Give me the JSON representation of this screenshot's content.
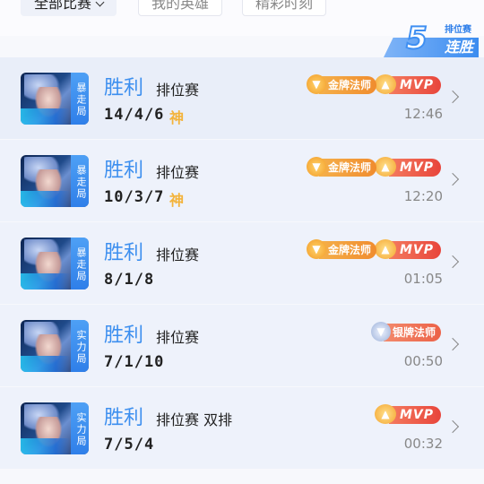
{
  "filters": [
    {
      "label": "全部比赛",
      "active": true
    },
    {
      "label": "我的英雄",
      "active": false
    },
    {
      "label": "精彩时刻",
      "active": false
    }
  ],
  "streak": {
    "count": "5",
    "sub_label": "排位赛",
    "label": "连胜"
  },
  "colors": {
    "accent": "#3d8fef",
    "gold": "#f3b33b",
    "tag_blue": "#2f7fe9"
  },
  "matches": [
    {
      "mode": "暴走局",
      "result": "胜利",
      "type": "排位赛",
      "kda": "14/4/6",
      "god": "神",
      "medal": "金牌法师",
      "medal_kind": "gold",
      "mvp": "MVP",
      "time": "12:46",
      "avatar_icon": "hero-portrait"
    },
    {
      "mode": "暴走局",
      "result": "胜利",
      "type": "排位赛",
      "kda": "10/3/7",
      "god": "神",
      "medal": "金牌法师",
      "medal_kind": "gold",
      "mvp": "MVP",
      "time": "12:20",
      "avatar_icon": "hero-portrait"
    },
    {
      "mode": "暴走局",
      "result": "胜利",
      "type": "排位赛",
      "kda": "8/1/8",
      "god": "",
      "medal": "金牌法师",
      "medal_kind": "gold",
      "mvp": "MVP",
      "time": "01:05",
      "avatar_icon": "hero-portrait"
    },
    {
      "mode": "实力局",
      "result": "胜利",
      "type": "排位赛",
      "kda": "7/1/10",
      "god": "",
      "medal": "银牌法师",
      "medal_kind": "silver",
      "mvp": "",
      "time": "00:50",
      "avatar_icon": "hero-portrait"
    },
    {
      "mode": "实力局",
      "result": "胜利",
      "type": "排位赛 双排",
      "kda": "7/5/4",
      "god": "",
      "medal": "",
      "medal_kind": "",
      "mvp": "MVP",
      "time": "00:32",
      "avatar_icon": "hero-portrait"
    }
  ]
}
